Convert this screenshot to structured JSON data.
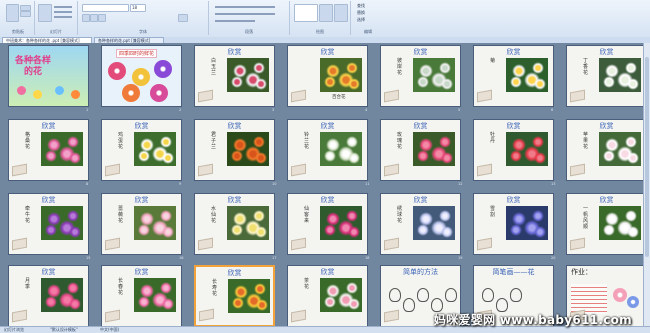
{
  "ribbon": {
    "groups": [
      "剪贴板",
      "幻灯片",
      "字体",
      "段落",
      "绘图",
      "编辑"
    ],
    "font_size": "18",
    "tools": [
      "查找",
      "替换",
      "选择"
    ]
  },
  "tabs": [
    "中班美术：各种各样的花 .ppt [兼容模式]",
    "各种各样的花.ppt [兼容模式]"
  ],
  "slides": [
    {
      "title": "各种各样的花",
      "subtitle": "",
      "type": "cover",
      "num": "1"
    },
    {
      "title": "",
      "subtitle": "四季四时的鲜花",
      "type": "seasons",
      "num": "2"
    },
    {
      "title": "欣赏",
      "name": "白玉兰",
      "num": "3",
      "caption": ""
    },
    {
      "title": "欣赏",
      "name": "",
      "num": "4",
      "caption": "百合花"
    },
    {
      "title": "欣赏",
      "name": "彼岸花",
      "num": "5",
      "caption": ""
    },
    {
      "title": "欣赏",
      "name": "菊",
      "num": "6",
      "caption": ""
    },
    {
      "title": "欣赏",
      "name": "丁香花",
      "num": "7",
      "caption": ""
    },
    {
      "title": "欣赏",
      "name": "格桑花",
      "num": "8",
      "caption": ""
    },
    {
      "title": "欣赏",
      "name": "鸡蛋花",
      "num": "9",
      "caption": ""
    },
    {
      "title": "欣赏",
      "name": "君子兰",
      "num": "10",
      "caption": ""
    },
    {
      "title": "欣赏",
      "name": "铃兰花",
      "num": "11",
      "caption": ""
    },
    {
      "title": "欣赏",
      "name": "玫瑰花",
      "num": "12",
      "caption": ""
    },
    {
      "title": "欣赏",
      "name": "牡丹",
      "num": "13",
      "caption": ""
    },
    {
      "title": "欣赏",
      "name": "苹果花",
      "num": "14",
      "caption": ""
    },
    {
      "title": "欣赏",
      "name": "牵牛花",
      "num": "15",
      "caption": ""
    },
    {
      "title": "欣赏",
      "name": "蔷薇花",
      "num": "16",
      "caption": ""
    },
    {
      "title": "欣赏",
      "name": "水仙花",
      "num": "17",
      "caption": ""
    },
    {
      "title": "欣赏",
      "name": "仙客来",
      "num": "18",
      "caption": ""
    },
    {
      "title": "欣赏",
      "name": "绣球花",
      "num": "19",
      "caption": ""
    },
    {
      "title": "欣赏",
      "name": "雪割",
      "num": "20",
      "caption": ""
    },
    {
      "title": "欣赏",
      "name": "一帆风顺",
      "num": "21",
      "caption": ""
    },
    {
      "title": "欣赏",
      "name": "月季",
      "num": "22",
      "caption": ""
    },
    {
      "title": "欣赏",
      "name": "长春花",
      "num": "23",
      "caption": ""
    },
    {
      "title": "欣赏",
      "name": "长寿花",
      "num": "24",
      "caption": ""
    },
    {
      "title": "欣赏",
      "name": "茶花",
      "num": "25",
      "caption": ""
    },
    {
      "title": "简单的方法",
      "name": "",
      "num": "26",
      "caption": "",
      "type": "method"
    },
    {
      "title": "简笔画——花",
      "name": "",
      "num": "27",
      "caption": "",
      "type": "sketch"
    },
    {
      "title": "作业：",
      "name": "",
      "num": "28",
      "caption": "",
      "type": "homework"
    }
  ],
  "status": {
    "left": "幻灯片浏览",
    "theme": "\"默认设计模板\"",
    "lang": "中文(中国)"
  },
  "watermark": "妈咪爱婴网 www.baby611.com",
  "colors": {
    "title_blue": "#3a63b8",
    "title_red": "#d33",
    "selection": "#f2a23a"
  }
}
